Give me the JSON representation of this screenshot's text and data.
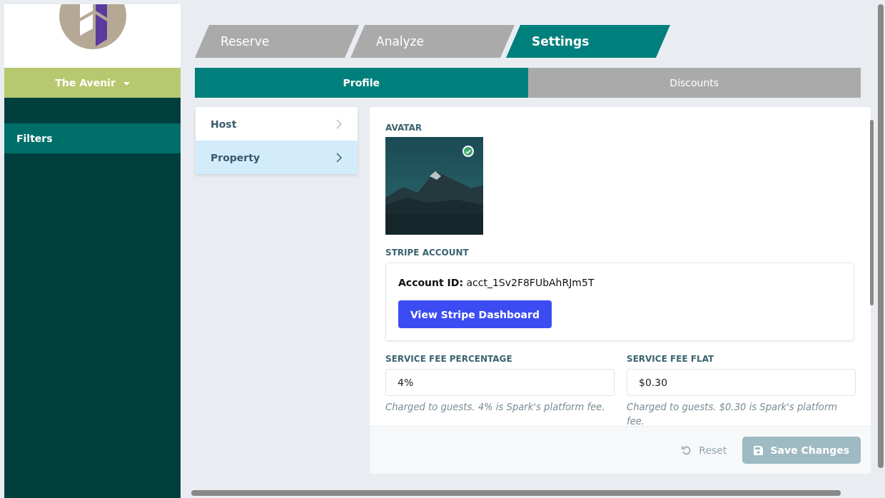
{
  "sidebar": {
    "property_menu": {
      "label": "The Avenir"
    },
    "items": [
      {
        "label": "Filters",
        "selected": true
      }
    ]
  },
  "tabs": [
    {
      "label": "Reserve",
      "selected": false
    },
    {
      "label": "Analyze",
      "selected": false
    },
    {
      "label": "Settings",
      "selected": true
    }
  ],
  "subtabs": [
    {
      "label": "Profile",
      "selected": true
    },
    {
      "label": "Discounts",
      "selected": false
    }
  ],
  "nav": [
    {
      "label": "Host",
      "selected": false
    },
    {
      "label": "Property",
      "selected": true
    }
  ],
  "avatar": {
    "label": "AVATAR",
    "kind": "picture",
    "verified": true
  },
  "stripe": {
    "label": "STRIPE ACCOUNT",
    "account_label": "Account ID:",
    "account_id": "acct_1Sv2F8FUbAhRJm5T",
    "button": "View Stripe Dashboard"
  },
  "fields": [
    {
      "label": "SERVICE FEE PERCENTAGE",
      "value": "4%",
      "help": "Charged to guests. 4% is Spark's platform fee."
    },
    {
      "label": "SERVICE FEE FLAT",
      "value": "$0.30",
      "help": "Charged to guests. $0.30 is Spark's platform fee."
    }
  ],
  "footer": {
    "reset": "Reset",
    "save": "Save Changes",
    "save_disabled": true
  }
}
